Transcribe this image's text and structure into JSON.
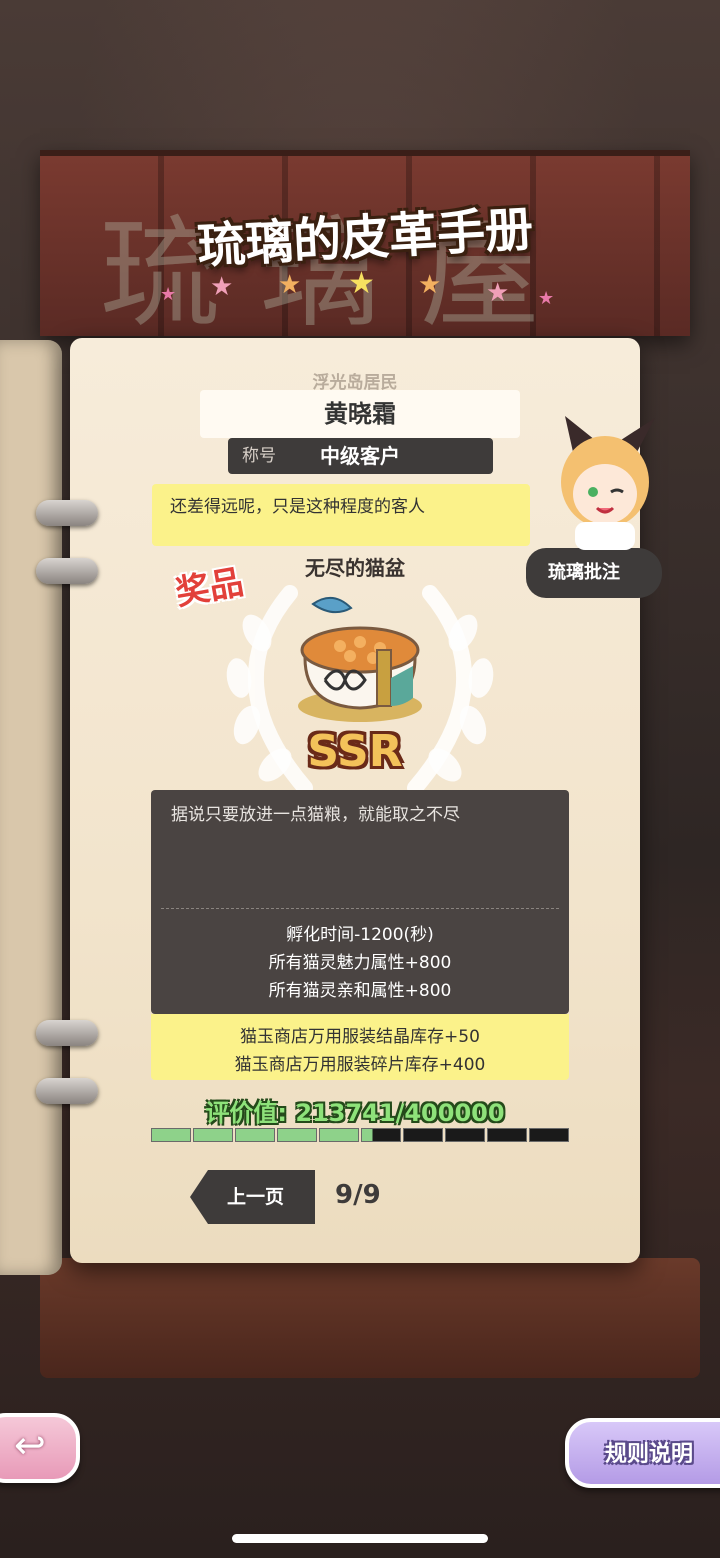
{
  "header": {
    "title": "琉璃的皮革手册"
  },
  "card": {
    "resident_label": "浮光岛居民",
    "customer_name": "黄晓霜",
    "title_key": "称号",
    "title_value": "中级客户",
    "comment": "还差得远呢，只是这种程度的客人"
  },
  "reward": {
    "tag": "奖品",
    "name": "无尽的猫盆",
    "rarity": "SSR",
    "description": "据说只要放进一点猫粮，就能取之不尽",
    "stats": [
      "孵化时间-1200(秒)",
      "所有猫灵魅力属性+800",
      "所有猫灵亲和属性+800"
    ],
    "bonuses": [
      "猫玉商店万用服装结晶库存+50",
      "猫玉商店万用服装碎片库存+400"
    ]
  },
  "score": {
    "text": "评价值: 213741/400000",
    "current": 213741,
    "max": 400000
  },
  "pager": {
    "prev_label": "上一页",
    "indicator": "9/9"
  },
  "side_tab": {
    "label": "琉璃批注"
  },
  "footer": {
    "back_icon": "return-arrow-icon",
    "rules_label": "规则说明"
  },
  "colors": {
    "accent_yellow": "#fbf28a",
    "progress_green": "#8ed28a",
    "dark_panel": "#4a4442",
    "rarity_gold": "#f3c25a"
  }
}
